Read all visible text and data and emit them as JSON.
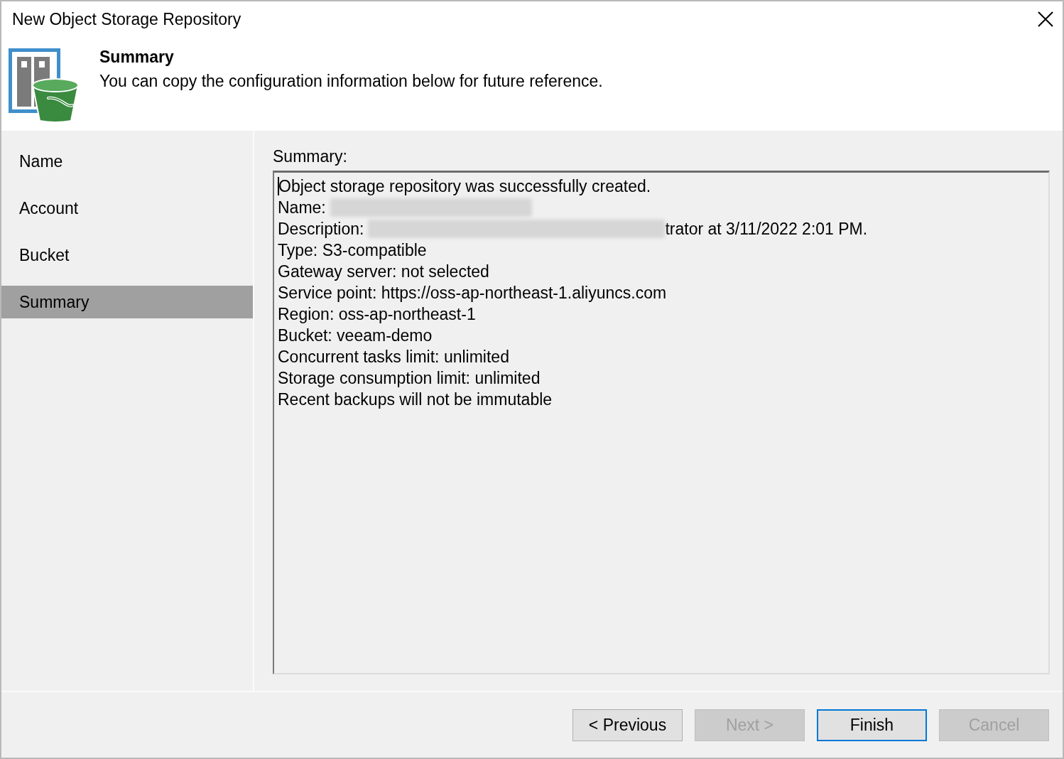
{
  "window": {
    "title": "New Object Storage Repository"
  },
  "header": {
    "title": "Summary",
    "subtitle": "You can copy the configuration information below for future reference."
  },
  "steps": [
    {
      "label": "Name",
      "selected": false
    },
    {
      "label": "Account",
      "selected": false
    },
    {
      "label": "Bucket",
      "selected": false
    },
    {
      "label": "Summary",
      "selected": true
    }
  ],
  "summary": {
    "label": "Summary:",
    "caret": true,
    "lines": [
      {
        "text": "Object storage repository was successfully created.",
        "redacted": false
      },
      {
        "text": "Name:",
        "redacted": true
      },
      {
        "text": "Description:",
        "redacted": true,
        "after": "trator at 3/11/2022 2:01 PM."
      },
      {
        "text": "Type: S3-compatible",
        "redacted": false
      },
      {
        "text": "Gateway server: not selected",
        "redacted": false
      },
      {
        "text": "Service point: https://oss-ap-northeast-1.aliyuncs.com",
        "redacted": false
      },
      {
        "text": "Region: oss-ap-northeast-1",
        "redacted": false
      },
      {
        "text": "Bucket: veeam-demo",
        "redacted": false
      },
      {
        "text": "Concurrent tasks limit: unlimited",
        "redacted": false
      },
      {
        "text": "Storage consumption limit: unlimited",
        "redacted": false
      },
      {
        "text": "Recent backups will not be immutable",
        "redacted": false
      }
    ]
  },
  "buttons": [
    {
      "label": "< Previous",
      "disabled": false,
      "default": false
    },
    {
      "label": "Next >",
      "disabled": true,
      "default": false
    },
    {
      "label": "Finish",
      "disabled": false,
      "default": true
    },
    {
      "label": "Cancel",
      "disabled": true,
      "default": false
    }
  ]
}
